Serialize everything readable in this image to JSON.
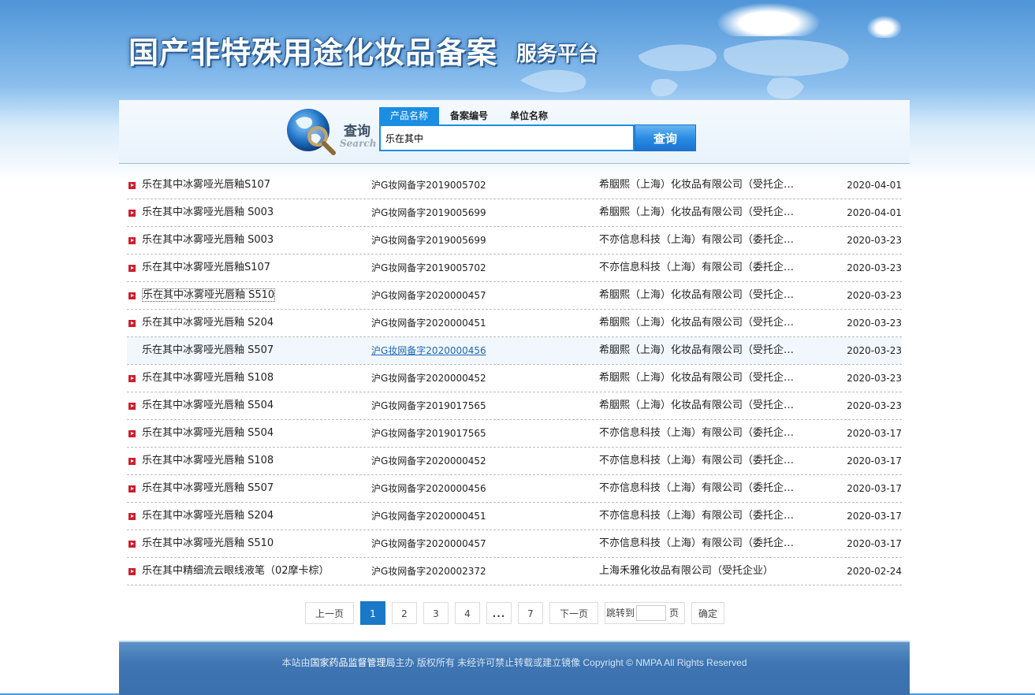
{
  "header": {
    "title": "国产非特殊用途化妆品备案",
    "subtitle": "服务平台"
  },
  "search": {
    "title": "查询",
    "title_en": "Search",
    "tabs": [
      "产品名称",
      "备案编号",
      "单位名称"
    ],
    "active_tab": "产品名称",
    "query": "乐在其中",
    "button_label": "查询"
  },
  "results": [
    {
      "name": "乐在其中冰雾哑光唇釉S107",
      "code": "沪G妆网备字2019005702",
      "company": "希胭熙（上海）化妆品有限公司（受托企…",
      "date": "2020-04-01"
    },
    {
      "name": "乐在其中冰雾哑光唇釉 S003",
      "code": "沪G妆网备字2019005699",
      "company": "希胭熙（上海）化妆品有限公司（受托企…",
      "date": "2020-04-01"
    },
    {
      "name": "乐在其中冰雾哑光唇釉 S003",
      "code": "沪G妆网备字2019005699",
      "company": "不亦信息科技（上海）有限公司（委托企…",
      "date": "2020-03-23"
    },
    {
      "name": "乐在其中冰雾哑光唇釉S107",
      "code": "沪G妆网备字2019005702",
      "company": "不亦信息科技（上海）有限公司（委托企…",
      "date": "2020-03-23"
    },
    {
      "name": "乐在其中冰雾哑光唇釉 S510",
      "code": "沪G妆网备字2020000457",
      "company": "希胭熙（上海）化妆品有限公司（受托企…",
      "date": "2020-03-23"
    },
    {
      "name": "乐在其中冰雾哑光唇釉 S204",
      "code": "沪G妆网备字2020000451",
      "company": "希胭熙（上海）化妆品有限公司（受托企…",
      "date": "2020-03-23"
    },
    {
      "name": "乐在其中冰雾哑光唇釉 S507",
      "code": "沪G妆网备字2020000456",
      "company": "希胭熙（上海）化妆品有限公司（受托企…",
      "date": "2020-03-23"
    },
    {
      "name": "乐在其中冰雾哑光唇釉 S108",
      "code": "沪G妆网备字2020000452",
      "company": "希胭熙（上海）化妆品有限公司（受托企…",
      "date": "2020-03-23"
    },
    {
      "name": "乐在其中冰雾哑光唇釉 S504",
      "code": "沪G妆网备字2019017565",
      "company": "希胭熙（上海）化妆品有限公司（受托企…",
      "date": "2020-03-23"
    },
    {
      "name": "乐在其中冰雾哑光唇釉 S504",
      "code": "沪G妆网备字2019017565",
      "company": "不亦信息科技（上海）有限公司（委托企…",
      "date": "2020-03-17"
    },
    {
      "name": "乐在其中冰雾哑光唇釉 S108",
      "code": "沪G妆网备字2020000452",
      "company": "不亦信息科技（上海）有限公司（委托企…",
      "date": "2020-03-17"
    },
    {
      "name": "乐在其中冰雾哑光唇釉 S507",
      "code": "沪G妆网备字2020000456",
      "company": "不亦信息科技（上海）有限公司（委托企…",
      "date": "2020-03-17"
    },
    {
      "name": "乐在其中冰雾哑光唇釉 S204",
      "code": "沪G妆网备字2020000451",
      "company": "不亦信息科技（上海）有限公司（委托企…",
      "date": "2020-03-17"
    },
    {
      "name": "乐在其中冰雾哑光唇釉 S510",
      "code": "沪G妆网备字2020000457",
      "company": "不亦信息科技（上海）有限公司（委托企…",
      "date": "2020-03-17"
    },
    {
      "name": "乐在其中精细流云眼线液笔（02摩卡棕）",
      "code": "沪G妆网备字2020002372",
      "company": "上海禾雅化妆品有限公司（受托企业）",
      "date": "2020-02-24"
    }
  ],
  "pagination": {
    "prev": "上一页",
    "pages": [
      "1",
      "2",
      "3",
      "4"
    ],
    "ellipsis": "...",
    "last": "7",
    "current": "1",
    "next": "下一页",
    "jump_label": "跳转到",
    "jump_value": "",
    "page_unit": "页",
    "confirm": "确定"
  },
  "footer": {
    "prefix": "本站由",
    "org": "国家药品监督管理局",
    "suffix": "主办 版权所有 未经许可禁止转载或建立镜像 Copyright © NMPA All Rights Reserved"
  },
  "colors": {
    "accent": "#1b8ee4",
    "bullet": "#cc1f2f",
    "link": "#1a68b3",
    "footer": "#3e75b2"
  }
}
